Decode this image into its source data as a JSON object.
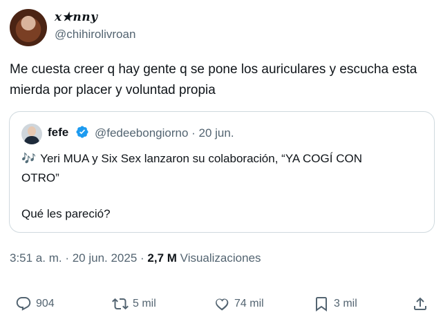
{
  "author": {
    "display_name": "x★nny",
    "handle": "@chihirolivroan"
  },
  "tweet": {
    "text": "Me cuesta creer q hay gente q se pone los auriculares y escucha esta mierda por placer y voluntad propia"
  },
  "quote": {
    "name": "fefe",
    "meta": "@fedeebongiorno · 20 jun.",
    "line1": "Yeri MUA y Six Sex lanzaron su colaboración, “YA COGÍ CON",
    "line2": "OTRO”",
    "line3": "Qué les pareció?",
    "emoji": "🎶",
    "verified_color": "#1d9bf0"
  },
  "meta": {
    "time_date": "3:51 a. m. · 20 jun. 2025 · ",
    "views_count": "2,7 M",
    "views_label": " Visualizaciones"
  },
  "actions": {
    "replies": "904",
    "reposts": "5 mil",
    "likes": "74 mil",
    "bookmarks": "3 mil"
  }
}
